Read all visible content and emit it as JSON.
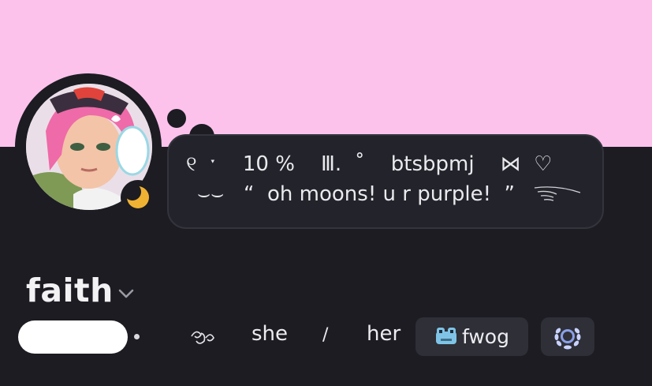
{
  "profile": {
    "banner_color": "#fdc2ec",
    "display_name": "faith",
    "status": {
      "line1": "୧  ˑ    10 %    Ⅲ.  ˚    btsbpmj    ⋈  ♡",
      "line2": "⌣⌣   “  oh moons! u r purple!  ”"
    },
    "pronouns": {
      "first": "she",
      "separator": "/",
      "second": "her"
    },
    "tag": {
      "label": "fwog",
      "icon": "frog-icon"
    },
    "badge_icon": "laurel-wreath-icon",
    "presence": "idle"
  },
  "colors": {
    "background": "#1c1c22",
    "bubble": "#23242b",
    "idle": "#f0b232",
    "badge_bg": "#2e2f37"
  }
}
